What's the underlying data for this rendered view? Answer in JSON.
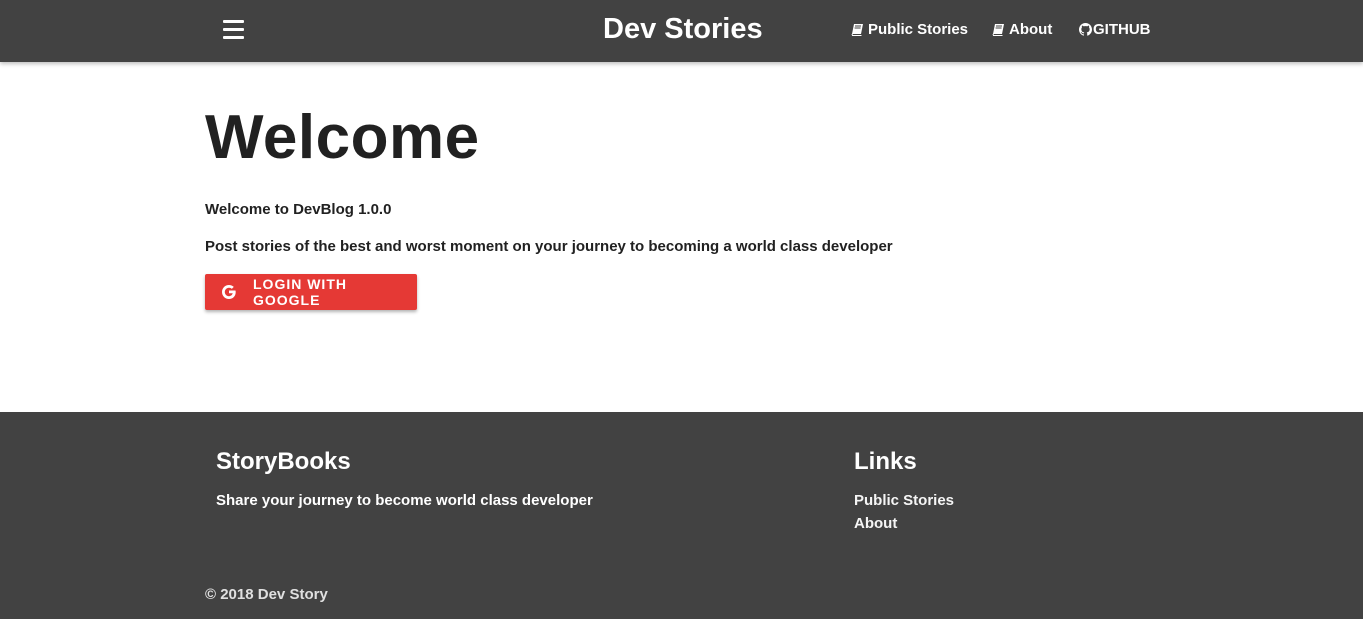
{
  "navbar": {
    "brand": "Dev Stories",
    "menu_icon": "hamburger-menu-icon",
    "links": [
      {
        "label": "Public Stories",
        "icon": "book-icon"
      },
      {
        "label": "About",
        "icon": "book-icon"
      },
      {
        "label": "GITHUB",
        "icon": "github-icon"
      }
    ]
  },
  "main": {
    "title": "Welcome",
    "welcome_text": "Welcome to DevBlog 1.0.0",
    "tagline": "Post stories of the best and worst moment on your journey to becoming a world class developer",
    "login_button": {
      "label": "LOGIN WITH GOOGLE",
      "icon": "google-icon"
    }
  },
  "footer": {
    "about_title": "StoryBooks",
    "about_text": "Share your journey to become world class developer",
    "links_title": "Links",
    "links": [
      "Public Stories",
      "About"
    ],
    "copyright": "© 2018 Dev Story"
  },
  "colors": {
    "navbar_bg": "#424242",
    "footer_bg": "#424242",
    "accent_red": "#e53935",
    "text_dark": "#212121"
  }
}
